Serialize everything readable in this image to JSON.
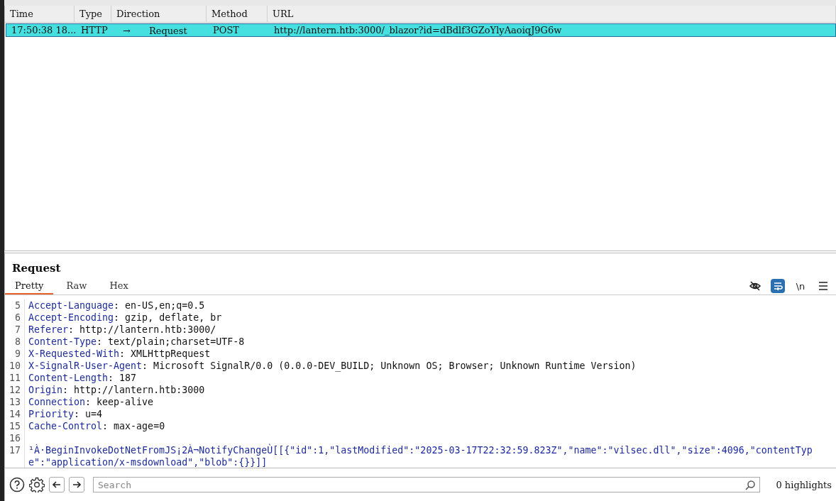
{
  "table": {
    "columns": [
      "Time",
      "Type",
      "Direction",
      "Method",
      "URL"
    ],
    "rows": [
      {
        "selected": true,
        "time": "17:50:38 18...",
        "type": "HTTP",
        "direction_icon": "→",
        "direction": "Request",
        "method": "POST",
        "url": "http://lantern.htb:3000/_blazor?id=dBdlf3GZoYlyAaoiqJ9G6w"
      }
    ]
  },
  "panel": {
    "title": "Request"
  },
  "tabs": [
    {
      "label": "Pretty",
      "selected": true
    },
    {
      "label": "Raw",
      "selected": false
    },
    {
      "label": "Hex",
      "selected": false
    }
  ],
  "editor_tools": [
    {
      "kind": "hide",
      "on": false
    },
    {
      "kind": "wrap",
      "on": true
    },
    {
      "kind": "newline",
      "label": "\\n",
      "on": false
    },
    {
      "kind": "menu",
      "on": false
    }
  ],
  "lines": [
    {
      "number": "5",
      "kind": "header",
      "name": "Accept-Language",
      "value": ": en-US,en;q=0.5"
    },
    {
      "number": "6",
      "kind": "header",
      "name": "Accept-Encoding",
      "value": ": gzip, deflate, br"
    },
    {
      "number": "7",
      "kind": "header",
      "name": "Referer",
      "value": ": http://lantern.htb:3000/"
    },
    {
      "number": "8",
      "kind": "header",
      "name": "Content-Type",
      "value": ": text/plain;charset=UTF-8"
    },
    {
      "number": "9",
      "kind": "header",
      "name": "X-Requested-With",
      "value": ": XMLHttpRequest"
    },
    {
      "number": "10",
      "kind": "header",
      "name": "X-SignalR-User-Agent",
      "value": ": Microsoft SignalR/0.0 (0.0.0-DEV_BUILD; Unknown OS; Browser; Unknown Runtime Version)"
    },
    {
      "number": "11",
      "kind": "header",
      "name": "Content-Length",
      "value": ": 187"
    },
    {
      "number": "12",
      "kind": "header",
      "name": "Origin",
      "value": ": http://lantern.htb:3000"
    },
    {
      "number": "13",
      "kind": "header",
      "name": "Connection",
      "value": ": keep-alive"
    },
    {
      "number": "14",
      "kind": "header",
      "name": "Priority",
      "value": ": u=4"
    },
    {
      "number": "15",
      "kind": "header",
      "name": "Cache-Control",
      "value": ": max-age=0"
    },
    {
      "number": "16",
      "kind": "blank"
    },
    {
      "number": "17",
      "kind": "body",
      "value": "¹À·BeginInvokeDotNetFromJS¡2À¬NotifyChangeÙ[[{\"id\":1,\"lastModified\":\"2025-03-17T22:32:59.823Z\",\"name\":\"vilsec.dll\",\"size\":4096,\"contentType\":\"application/x-msdownload\",\"blob\":{}}]]"
    }
  ],
  "footer": {
    "search": {
      "placeholder": "Search"
    },
    "highlights": "0 highlights"
  }
}
